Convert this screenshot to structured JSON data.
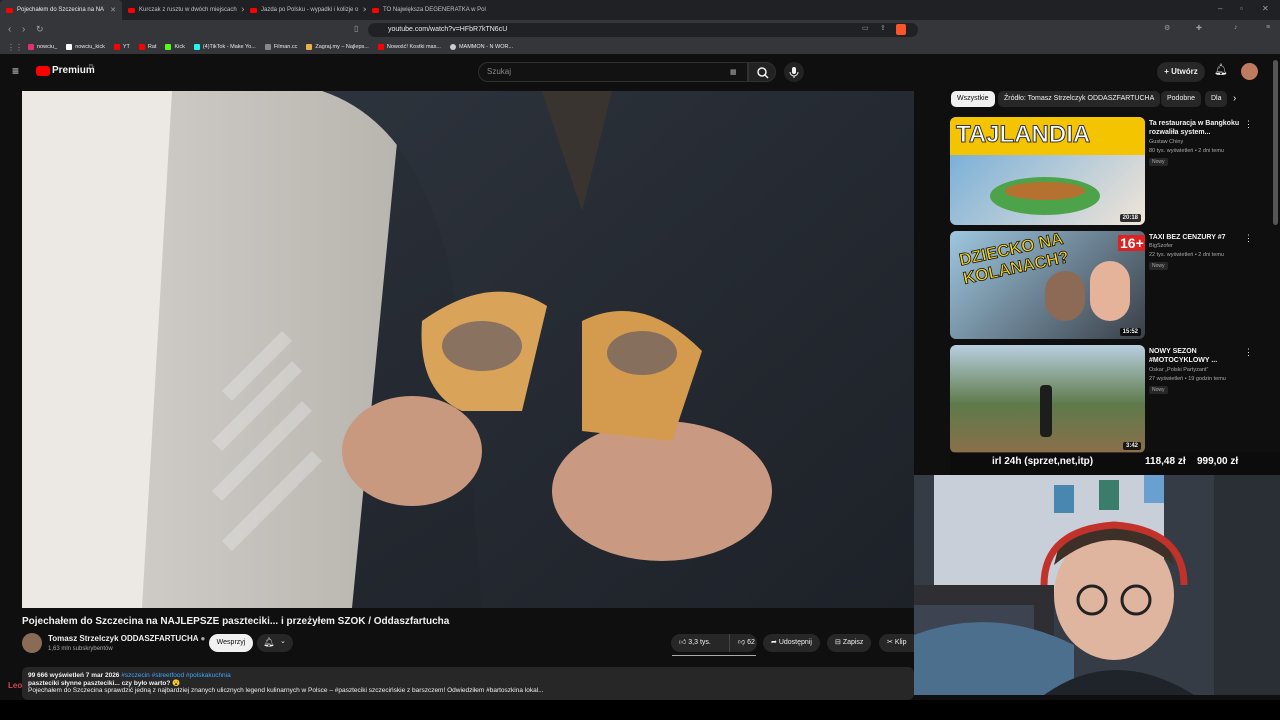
{
  "browser": {
    "tabs": [
      {
        "label": "Pojechałem do Szczecina na NA",
        "active": true
      },
      {
        "label": "Kurczak z rusztu w dwóch miejscach",
        "active": false
      },
      {
        "label": "Jazda po Polsku - wypadki i kolizje o",
        "active": false
      },
      {
        "label": "TO Największa DEGENERATKA w Pol",
        "active": false
      }
    ],
    "url": "youtube.com/watch?v=HFbR7kTN6cU",
    "bookmarks": [
      "nowciu_",
      "nowciu_kick",
      "YT",
      "Rat",
      "Kick",
      "(4)TikTok - Make Yo...",
      "Filman.cc",
      "Zagraj.my – Najleps...",
      "Nowość! Kostki mas...",
      "MAMMON - N WOR..."
    ]
  },
  "header": {
    "logo": "Premium",
    "logo_sup": "PL",
    "search_placeholder": "Szukaj",
    "create_label": "Utwórz"
  },
  "video": {
    "title": "Pojechałem do Szczecina na NAJLEPSZE paszteciki... i przeżyłem SZOK / Oddaszfartucha",
    "channel": "Tomasz Strzelczyk ODDASZFARTUCHA",
    "subscribers": "1,63 mln subskrybentów",
    "join_label": "Wesprzyj",
    "likes": "3,3 tys.",
    "dislikes": "62",
    "share_label": "Udostępnij",
    "save_label": "Zapisz",
    "clip_label": "Klip",
    "views_date": "99 666 wyświetleń  7 mar 2026",
    "hashtags": "#szczecin #streetfood #polskakuchnia",
    "desc_line": "paszteciki słynne paszteciki... czy było warto? 😮",
    "desc_line2": "Pojechałem do Szczecina sprawdzić jedną z najbardziej znanych ulicznych legend kulinarnych w Polsce – #paszteciki szczecińskie z barszczem! Odwiedziłem #bartoszkina lokal...",
    "user_tag": "Leo"
  },
  "chips": [
    "Wszystkie",
    "Źródło: Tomasz Strzelczyk ODDASZFARTUCHA",
    "Podobne",
    "Dla"
  ],
  "recommendations": [
    {
      "title": "Ta restauracja w Bangkoku rozwaliła system...",
      "channel": "Gustaw Chiny",
      "meta": "80 tys. wyświetleń • 2 dni temu",
      "badge": "Nowy",
      "duration": "20:18",
      "thumb_text": "TAJLANDIA"
    },
    {
      "title": "TAXI BEZ CENZURY #7",
      "channel": "BigSzofer",
      "meta": "22 tys. wyświetleń • 2 dni temu",
      "badge": "Nowy",
      "duration": "15:52",
      "thumb_text": "DZIECKO NA KOLANACH?",
      "thumb_badge": "16+"
    },
    {
      "title": "NOWY SEZON #MOTOCYKLOWY ...",
      "channel": "Oskar „Polski Partyzant”",
      "meta": "27 wyświetleń • 19 godzin temu",
      "badge": "Nowy",
      "duration": "3:42"
    }
  ],
  "overlay": {
    "ticker_left": "irl 24h (sprzet,net,itp)",
    "ticker_mid": "118,48 zł",
    "ticker_right": "999,00 zł"
  }
}
